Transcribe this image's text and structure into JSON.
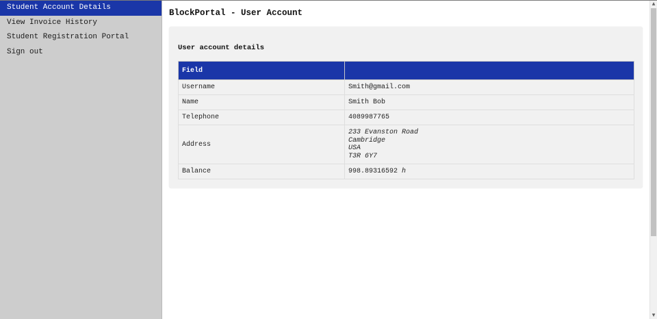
{
  "sidebar": {
    "items": [
      {
        "label": "Student Account Details",
        "active": true
      },
      {
        "label": "View Invoice History",
        "active": false
      },
      {
        "label": "Student Registration Portal",
        "active": false
      },
      {
        "label": "Sign out",
        "active": false
      }
    ]
  },
  "main": {
    "title": "BlockPortal - User Account",
    "card": {
      "title": "User account details",
      "table": {
        "headers": [
          "Field",
          ""
        ],
        "rows": {
          "username": {
            "field": "Username",
            "value": "Smith@gmail.com"
          },
          "name": {
            "field": "Name",
            "value": "Smith Bob"
          },
          "telephone": {
            "field": "Telephone",
            "value": "4089987765"
          },
          "address": {
            "field": "Address",
            "lines": [
              "233 Evanston Road",
              "Cambridge",
              "USA",
              "T3R 6Y7"
            ]
          },
          "balance": {
            "field": "Balance",
            "value": "998.89316592",
            "unit": "h"
          }
        }
      }
    }
  },
  "colors": {
    "accent": "#1a36a8",
    "sidebar_bg": "#cdcdcd",
    "card_bg": "#f1f1f1"
  },
  "icons": {
    "scroll_up": "scroll-up-arrow-icon",
    "scroll_down": "scroll-down-arrow-icon"
  }
}
